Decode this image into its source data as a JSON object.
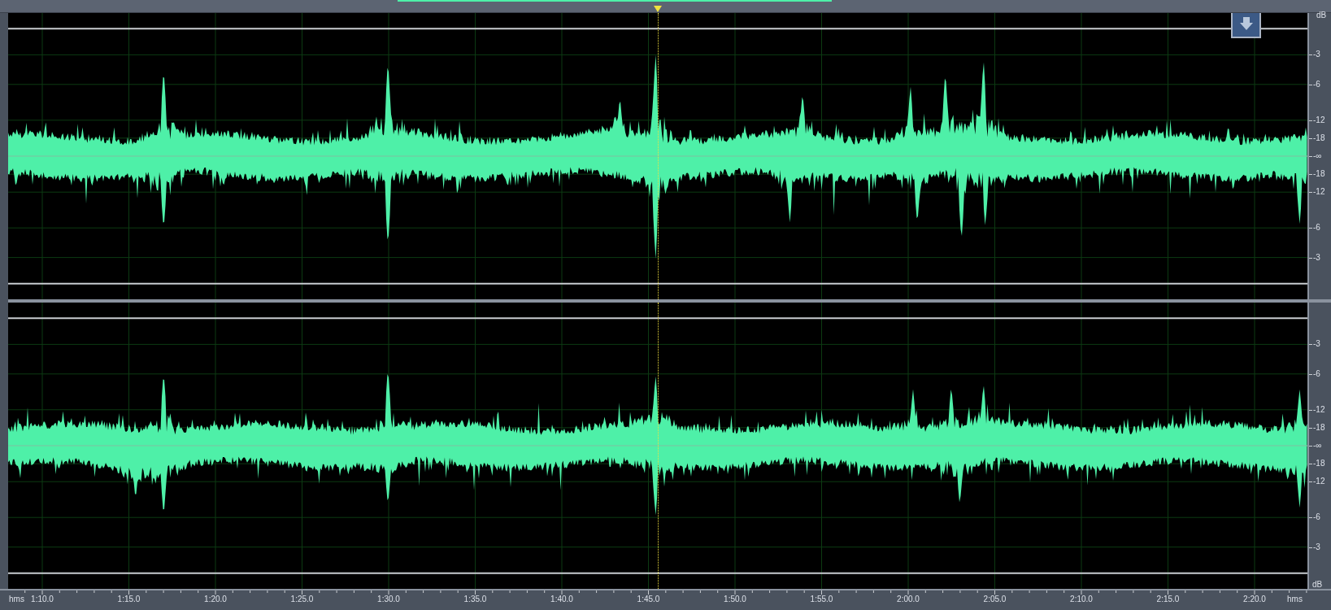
{
  "cursor": {
    "level": 0.5
  },
  "channels": [
    {
      "unit": "dB",
      "labels": [
        "-3",
        "-6",
        "-12",
        "-18",
        "-∞",
        "-18",
        "-12",
        "-6",
        "-3"
      ]
    },
    {
      "labels": [
        "-3",
        "-6",
        "-12",
        "-18",
        "-∞",
        "-18",
        "-12",
        "-6",
        "-3"
      ]
    }
  ],
  "time_ruler": {
    "unit_left": "hms",
    "ticks": [
      "1:10.0",
      "1:15.0",
      "1:20.0",
      "1:25.0",
      "1:30.0",
      "1:35.0",
      "1:40.0",
      "1:45.0",
      "1:50.0",
      "1:55.0",
      "2:00.0",
      "2:05.0",
      "2:10.0",
      "2:15.0",
      "2:20.0"
    ],
    "unit_right": "hms",
    "corner_unit": "dB"
  }
}
